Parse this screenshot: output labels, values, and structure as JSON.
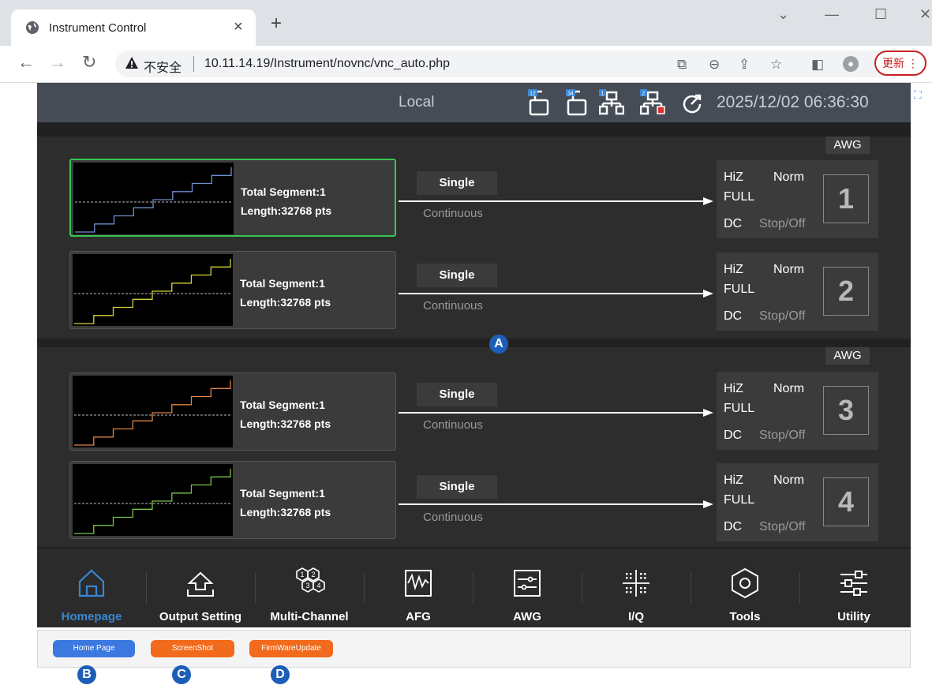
{
  "browser": {
    "tab_title": "Instrument Control",
    "new_tab": "+",
    "security_label": "不安全",
    "url": "10.11.14.19/Instrument/novnc/vnc_auto.php",
    "update_label": "更新"
  },
  "status": {
    "mode": "Local",
    "datetime": "2025/12/02 06:36:30"
  },
  "bands": [
    {
      "tag": "AWG"
    },
    {
      "tag": "AWG"
    }
  ],
  "channels": [
    {
      "number": "1",
      "segment": "Total Segment:1",
      "length": "Length:32768 pts",
      "single": "Single",
      "continuous": "Continuous",
      "hiz": "HiZ",
      "norm": "Norm",
      "full": "FULL",
      "dc": "DC",
      "stop": "Stop/Off",
      "color": "#6f8fd0",
      "selected": true
    },
    {
      "number": "2",
      "segment": "Total Segment:1",
      "length": "Length:32768 pts",
      "single": "Single",
      "continuous": "Continuous",
      "hiz": "HiZ",
      "norm": "Norm",
      "full": "FULL",
      "dc": "DC",
      "stop": "Stop/Off",
      "color": "#d4d23a",
      "selected": false
    },
    {
      "number": "3",
      "segment": "Total Segment:1",
      "length": "Length:32768 pts",
      "single": "Single",
      "continuous": "Continuous",
      "hiz": "HiZ",
      "norm": "Norm",
      "full": "FULL",
      "dc": "DC",
      "stop": "Stop/Off",
      "color": "#e0834a",
      "selected": false
    },
    {
      "number": "4",
      "segment": "Total Segment:1",
      "length": "Length:32768 pts",
      "single": "Single",
      "continuous": "Continuous",
      "hiz": "HiZ",
      "norm": "Norm",
      "full": "FULL",
      "dc": "DC",
      "stop": "Stop/Off",
      "color": "#7cc24a",
      "selected": false
    }
  ],
  "markers": {
    "a": "A",
    "b": "B",
    "c": "C",
    "d": "D"
  },
  "nav": [
    {
      "label": "Homepage",
      "icon": "home-icon",
      "active": true
    },
    {
      "label": "Output Setting",
      "icon": "output-icon",
      "active": false
    },
    {
      "label": "Multi-Channel",
      "icon": "multi-channel-icon",
      "active": false
    },
    {
      "label": "AFG",
      "icon": "afg-icon",
      "active": false
    },
    {
      "label": "AWG",
      "icon": "awg-icon",
      "active": false
    },
    {
      "label": "I/Q",
      "icon": "iq-icon",
      "active": false
    },
    {
      "label": "Tools",
      "icon": "tools-icon",
      "active": false
    },
    {
      "label": "Utility",
      "icon": "utility-icon",
      "active": false
    }
  ],
  "pagebar": {
    "home": "Home Page",
    "screenshot": "ScreenShot",
    "firmware": "FirmWareUpdate"
  },
  "colors": {
    "active": "#3a86d4",
    "home_btn": "#3b79e0",
    "orange_btn": "#f26a1b",
    "selection": "#36c752"
  }
}
